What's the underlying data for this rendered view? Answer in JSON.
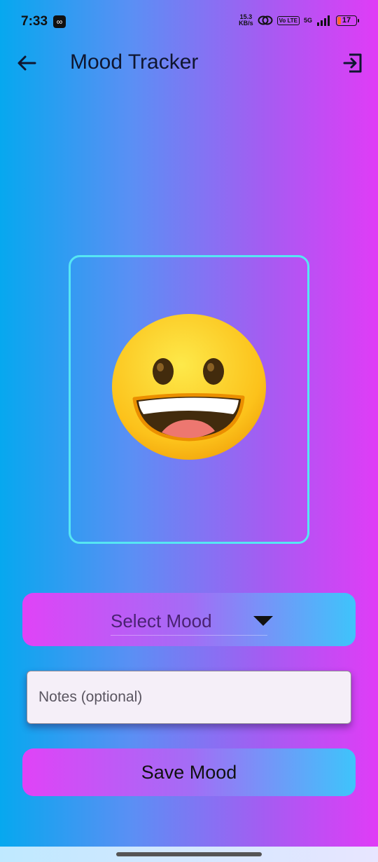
{
  "status_bar": {
    "time": "7:33",
    "net_speed_value": "15.3",
    "net_speed_unit": "KB/s",
    "volte": "Vo LTE",
    "network": "5G",
    "battery_level": "17",
    "battery_color": "#ff6a2b"
  },
  "app_bar": {
    "title": "Mood Tracker",
    "back_icon": "arrow-left-icon",
    "logout_icon": "logout-icon"
  },
  "mood_display": {
    "emoji": "grinning-face",
    "frame_color": "#56e6f3"
  },
  "mood_select": {
    "label": "Select Mood"
  },
  "notes": {
    "placeholder": "Notes (optional)",
    "value": ""
  },
  "save_button": {
    "label": "Save Mood"
  },
  "colors": {
    "gradient_start": "#06a8ef",
    "gradient_end": "#e03cf6",
    "button_gradient_start": "#e043f7",
    "button_gradient_end": "#3ec4fb"
  }
}
